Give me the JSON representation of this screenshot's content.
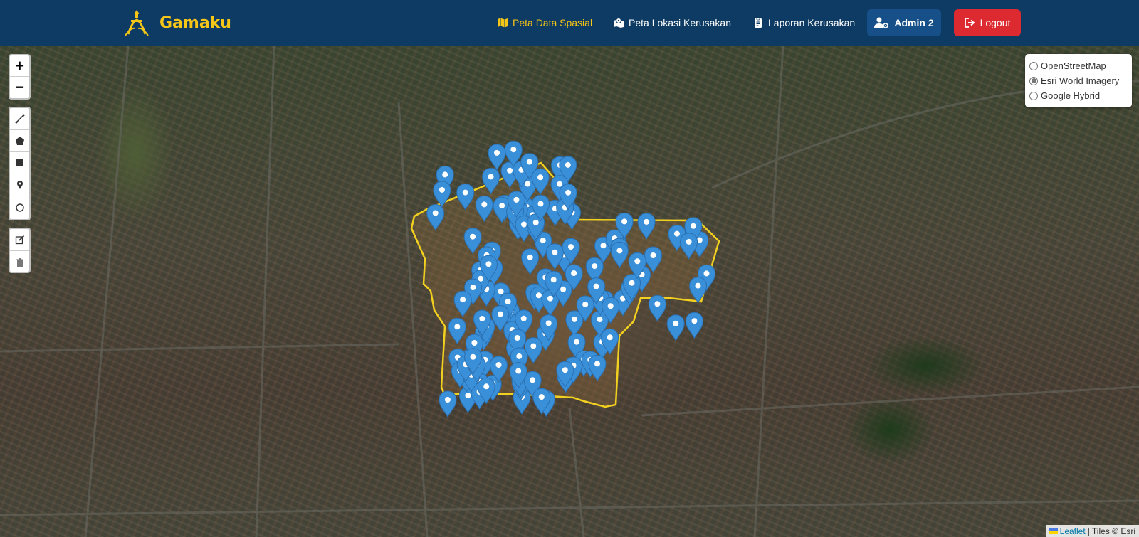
{
  "brand": {
    "name": "Gamaku"
  },
  "nav": [
    {
      "label": "Peta Data Spasial",
      "icon": "map-icon",
      "active": true
    },
    {
      "label": "Peta Lokasi Kerusakan",
      "icon": "map-location-icon",
      "active": false
    },
    {
      "label": "Laporan Kerusakan",
      "icon": "clipboard-icon",
      "active": false
    }
  ],
  "user": {
    "label": "Admin 2",
    "icon": "user-gear-icon"
  },
  "logout": {
    "label": "Logout",
    "icon": "logout-icon"
  },
  "map": {
    "zoom_in": "+",
    "zoom_out": "−",
    "draw_tools": [
      "polyline-icon",
      "polygon-icon",
      "rectangle-icon",
      "marker-icon",
      "circle-icon"
    ],
    "edit_tools": [
      "edit-icon",
      "delete-icon"
    ],
    "layers": [
      {
        "label": "OpenStreetMap",
        "selected": false
      },
      {
        "label": "Esri World Imagery",
        "selected": true
      },
      {
        "label": "Google Hybrid",
        "selected": false
      }
    ],
    "attribution": {
      "leaflet": "Leaflet",
      "rest": "| Tiles © Esri"
    },
    "marker_color": "#3a8fd9",
    "boundary_color": "#f2d01f"
  },
  "colors": {
    "navbar": "#0d3b63",
    "accent": "#f5c518",
    "logout": "#dc2a30",
    "admin": "#175089"
  }
}
